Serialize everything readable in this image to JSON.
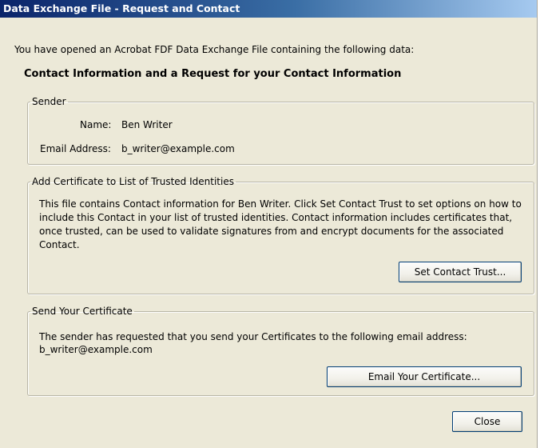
{
  "window": {
    "title": "Data Exchange File - Request and Contact"
  },
  "intro": {
    "text": "You have opened an Acrobat FDF Data Exchange File containing the following data:",
    "heading": "Contact Information and a Request for your Contact Information"
  },
  "sender": {
    "legend": "Sender",
    "name_label": "Name:",
    "name_value": "Ben Writer",
    "email_label": "Email Address:",
    "email_value": "b_writer@example.com"
  },
  "trust": {
    "legend": "Add Certificate to List of Trusted Identities",
    "description": "This file contains Contact information for Ben Writer. Click Set Contact Trust to set options on how to include this Contact in your list of trusted identities. Contact information includes certificates that, once trusted, can be used to validate signatures from and encrypt documents for the associated Contact.",
    "button_label": "Set Contact Trust..."
  },
  "send_certificate": {
    "legend": "Send Your Certificate",
    "description": "The sender has requested that you send your Certificates to the following email address:",
    "email": "b_writer@example.com",
    "button_label": "Email Your Certificate..."
  },
  "footer": {
    "close_label": "Close"
  }
}
